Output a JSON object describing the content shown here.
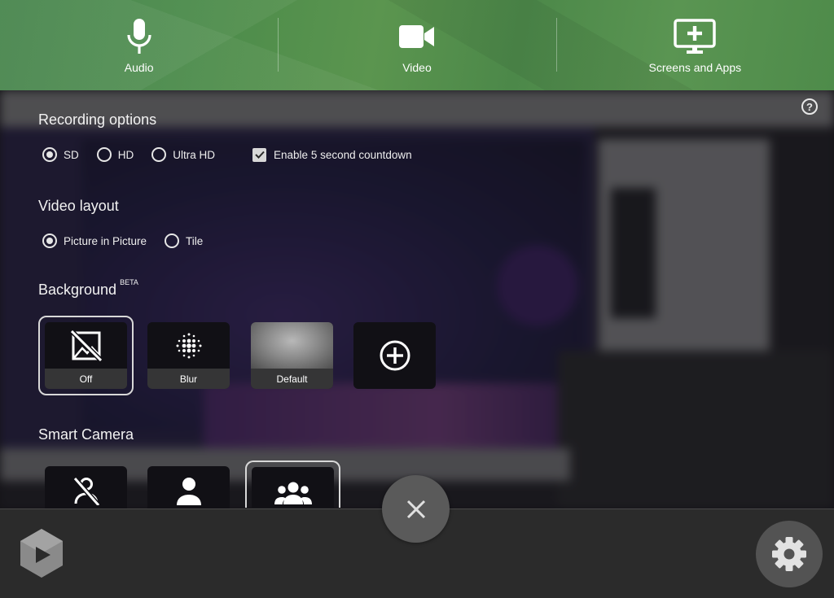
{
  "tabs": [
    {
      "label": "Audio",
      "icon": "microphone-icon"
    },
    {
      "label": "Video",
      "icon": "video-camera-icon"
    },
    {
      "label": "Screens and Apps",
      "icon": "screen-add-icon"
    }
  ],
  "recording_options": {
    "title": "Recording options",
    "quality_options": [
      "SD",
      "HD",
      "Ultra HD"
    ],
    "quality_selected": "SD",
    "countdown_label": "Enable 5 second countdown",
    "countdown_checked": true
  },
  "video_layout": {
    "title": "Video layout",
    "options": [
      "Picture in Picture",
      "Tile"
    ],
    "selected": "Picture in Picture"
  },
  "background": {
    "title": "Background",
    "badge": "BETA",
    "tiles": [
      {
        "label": "Off",
        "icon": "no-image-icon",
        "selected": true
      },
      {
        "label": "Blur",
        "icon": "blur-icon",
        "selected": false
      },
      {
        "label": "Default",
        "icon": "default-background-image",
        "selected": false
      },
      {
        "label": "",
        "icon": "add-circle-icon",
        "selected": false
      }
    ]
  },
  "smart_camera": {
    "title": "Smart Camera",
    "options": [
      {
        "icon": "person-off-icon",
        "selected": false
      },
      {
        "icon": "person-icon",
        "selected": false
      },
      {
        "icon": "group-icon",
        "selected": true
      }
    ]
  },
  "help_icon": "?",
  "colors": {
    "topbar_green": "#4e8b4a",
    "panel_dark": "#1d1b22",
    "bottom_bar": "#2b2b2b"
  }
}
